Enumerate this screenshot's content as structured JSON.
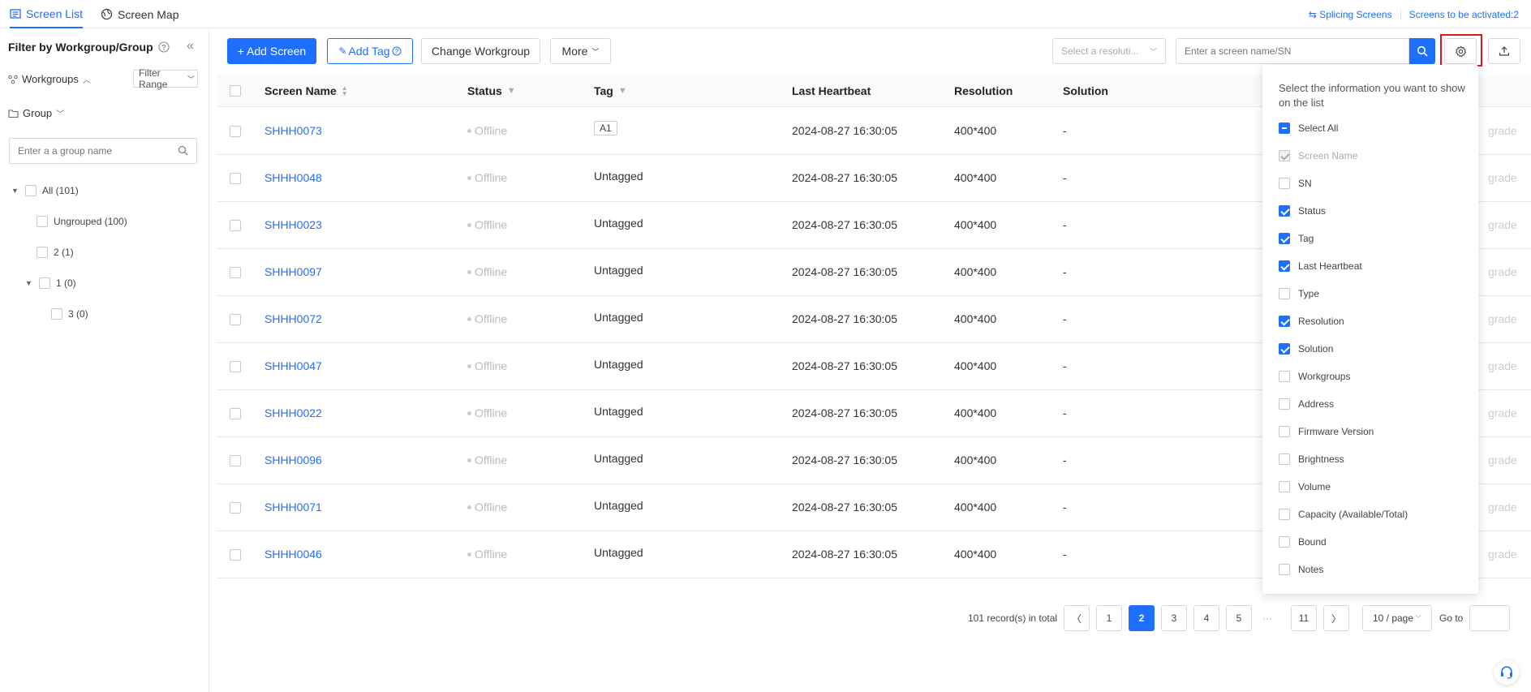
{
  "tabs": [
    {
      "label": "Screen List",
      "active": true
    },
    {
      "label": "Screen Map",
      "active": false
    }
  ],
  "top_links": {
    "splicing": "Splicing Screens",
    "to_activate": "Screens to be activated:2"
  },
  "sidebar": {
    "title": "Filter by Workgroup/Group",
    "workgroups_label": "Workgroups",
    "filter_range_label": "Filter Range",
    "group_label": "Group",
    "search_placeholder": "Enter a a group name",
    "tree": [
      {
        "label": "All (101)",
        "level": 0,
        "expanded": true
      },
      {
        "label": "Ungrouped (100)",
        "level": 1
      },
      {
        "label": "2 (1)",
        "level": 1
      },
      {
        "label": "1 (0)",
        "level": 1,
        "expanded": true
      },
      {
        "label": "3 (0)",
        "level": 2
      }
    ]
  },
  "toolbar": {
    "add_screen": "+ Add Screen",
    "add_tag": "Add Tag",
    "change_workgroup": "Change Workgroup",
    "more": "More",
    "resolution_placeholder": "Select a resoluti...",
    "search_placeholder": "Enter a screen name/SN"
  },
  "table": {
    "headers": {
      "screen_name": "Screen Name",
      "status": "Status",
      "tag": "Tag",
      "last_heartbeat": "Last Heartbeat",
      "resolution": "Resolution",
      "solution": "Solution"
    },
    "rows": [
      {
        "name": "SHHH0073",
        "status": "Offline",
        "tag": "A1",
        "tag_chip": true,
        "heartbeat": "2024-08-27 16:30:05",
        "resolution": "400*400",
        "solution": "-",
        "action": "grade"
      },
      {
        "name": "SHHH0048",
        "status": "Offline",
        "tag": "Untagged",
        "heartbeat": "2024-08-27 16:30:05",
        "resolution": "400*400",
        "solution": "-",
        "action": "grade"
      },
      {
        "name": "SHHH0023",
        "status": "Offline",
        "tag": "Untagged",
        "heartbeat": "2024-08-27 16:30:05",
        "resolution": "400*400",
        "solution": "-",
        "action": "grade"
      },
      {
        "name": "SHHH0097",
        "status": "Offline",
        "tag": "Untagged",
        "heartbeat": "2024-08-27 16:30:05",
        "resolution": "400*400",
        "solution": "-",
        "action": "grade"
      },
      {
        "name": "SHHH0072",
        "status": "Offline",
        "tag": "Untagged",
        "heartbeat": "2024-08-27 16:30:05",
        "resolution": "400*400",
        "solution": "-",
        "action": "grade"
      },
      {
        "name": "SHHH0047",
        "status": "Offline",
        "tag": "Untagged",
        "heartbeat": "2024-08-27 16:30:05",
        "resolution": "400*400",
        "solution": "-",
        "action": "grade"
      },
      {
        "name": "SHHH0022",
        "status": "Offline",
        "tag": "Untagged",
        "heartbeat": "2024-08-27 16:30:05",
        "resolution": "400*400",
        "solution": "-",
        "action": "grade"
      },
      {
        "name": "SHHH0096",
        "status": "Offline",
        "tag": "Untagged",
        "heartbeat": "2024-08-27 16:30:05",
        "resolution": "400*400",
        "solution": "-",
        "action": "grade"
      },
      {
        "name": "SHHH0071",
        "status": "Offline",
        "tag": "Untagged",
        "heartbeat": "2024-08-27 16:30:05",
        "resolution": "400*400",
        "solution": "-",
        "action": "grade"
      },
      {
        "name": "SHHH0046",
        "status": "Offline",
        "tag": "Untagged",
        "heartbeat": "2024-08-27 16:30:05",
        "resolution": "400*400",
        "solution": "-",
        "action": "grade"
      }
    ]
  },
  "pagination": {
    "total": "101 record(s) in total",
    "pages": [
      "1",
      "2",
      "3",
      "4",
      "5"
    ],
    "current": "2",
    "ellipsis": "···",
    "last": "11",
    "per_page": "10 / page",
    "goto_label": "Go to"
  },
  "column_panel": {
    "header": "Select the information you want to show on the list",
    "items": [
      {
        "label": "Select All",
        "state": "indeterminate"
      },
      {
        "label": "Screen Name",
        "state": "disabled-checked"
      },
      {
        "label": "SN",
        "state": "unchecked"
      },
      {
        "label": "Status",
        "state": "checked"
      },
      {
        "label": "Tag",
        "state": "checked"
      },
      {
        "label": "Last Heartbeat",
        "state": "checked"
      },
      {
        "label": "Type",
        "state": "unchecked"
      },
      {
        "label": "Resolution",
        "state": "checked"
      },
      {
        "label": "Solution",
        "state": "checked"
      },
      {
        "label": "Workgroups",
        "state": "unchecked"
      },
      {
        "label": "Address",
        "state": "unchecked"
      },
      {
        "label": "Firmware Version",
        "state": "unchecked"
      },
      {
        "label": "Brightness",
        "state": "unchecked"
      },
      {
        "label": "Volume",
        "state": "unchecked"
      },
      {
        "label": "Capacity (Available/Total)",
        "state": "unchecked"
      },
      {
        "label": "Bound",
        "state": "unchecked"
      },
      {
        "label": "Notes",
        "state": "unchecked"
      }
    ]
  },
  "colors": {
    "accent": "#1f6fff",
    "highlight_border": "#e0151b",
    "muted": "#bbbbbb"
  }
}
